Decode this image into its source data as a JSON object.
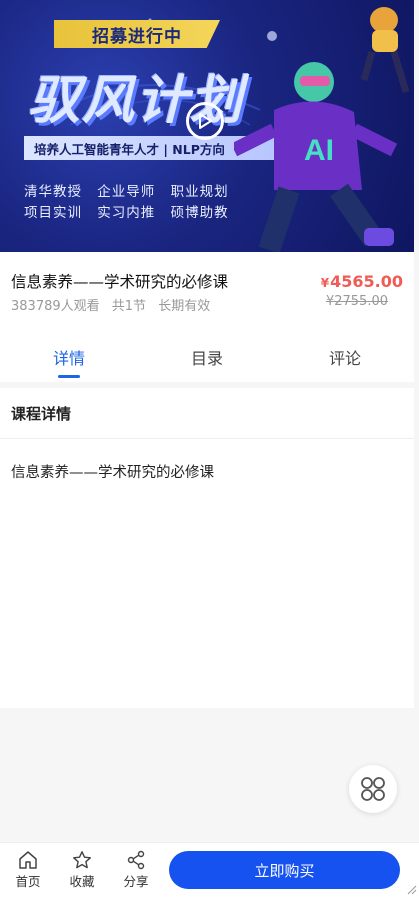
{
  "banner": {
    "recruit_label": "招募进行中",
    "title": "驭风计划",
    "tagline": "培养人工智能青年人才 | NLP方向",
    "features_row1": [
      "清华教授",
      "企业导师",
      "职业规划"
    ],
    "features_row2": [
      "项目实训",
      "实习内推",
      "硕博助教"
    ],
    "play_icon": "play-icon"
  },
  "course": {
    "title": "信息素养——学术研究的必修课",
    "views": "383789人观看",
    "lessons": "共1节",
    "validity": "长期有效",
    "currency": "¥",
    "price": "4565.00",
    "original_price": "¥2755.00"
  },
  "tabs": [
    {
      "label": "详情",
      "active": true
    },
    {
      "label": "目录",
      "active": false
    },
    {
      "label": "评论",
      "active": false
    }
  ],
  "details": {
    "heading": "课程详情",
    "body": "信息素养——学术研究的必修课"
  },
  "bottom_bar": {
    "home_label": "首页",
    "favorite_label": "收藏",
    "share_label": "分享",
    "buy_label": "立即购买"
  },
  "colors": {
    "accent": "#1d64e6",
    "buy_button": "#1652f0",
    "price": "#f15b55"
  }
}
